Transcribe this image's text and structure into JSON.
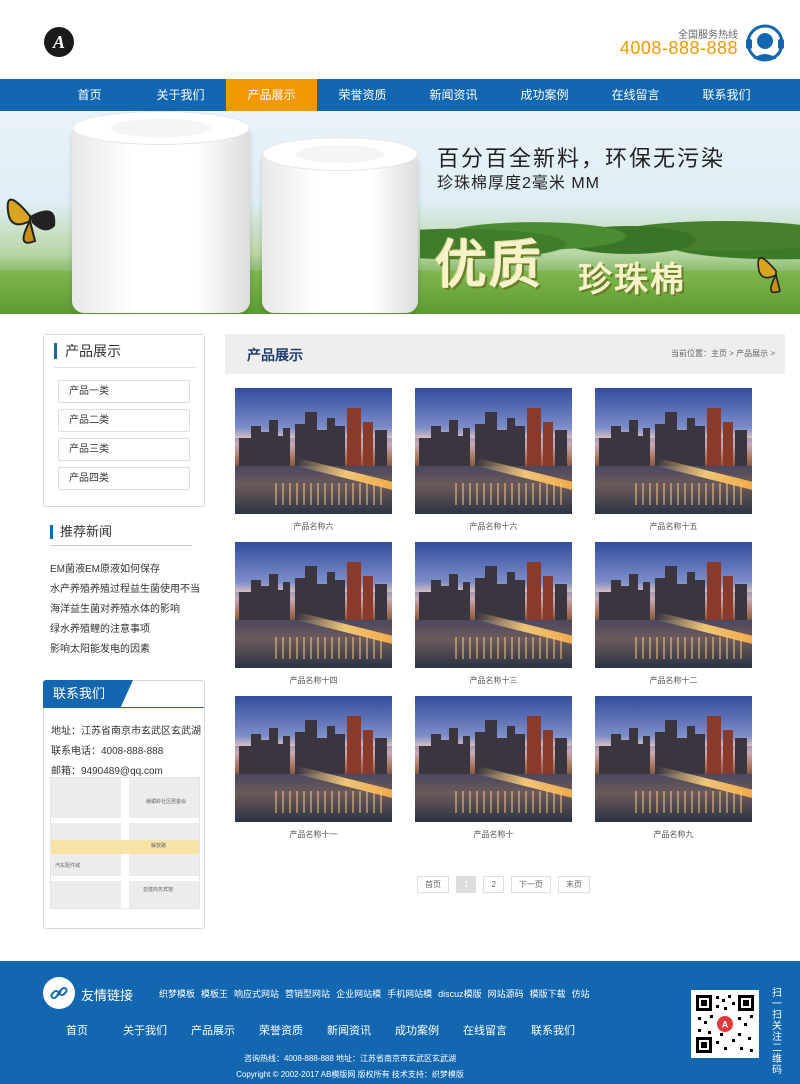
{
  "header": {
    "logo_letter": "A",
    "hotline_label": "全国服务热线",
    "hotline_number": "4008-888-888"
  },
  "nav": {
    "items": [
      "首页",
      "关于我们",
      "产品展示",
      "荣誉资质",
      "新闻资讯",
      "成功案例",
      "在线留言",
      "联系我们"
    ],
    "active": "产品展示"
  },
  "banner": {
    "line1": "百分百全新料，环保无污染",
    "line2": "珍珠棉厚度2毫米 MM",
    "big1": "优质",
    "big2": "珍珠棉"
  },
  "sidebar": {
    "category_title": "产品展示",
    "categories": [
      "产品一类",
      "产品二类",
      "产品三类",
      "产品四类"
    ],
    "news_title": "推荐新闻",
    "news": [
      "EM菌液EM原液如何保存",
      "水产养殖养殖过程益生菌使用不当",
      "海洋益生菌对养殖水体的影响",
      "绿水养殖鲤的注意事项",
      "影响太阳能发电的因素"
    ],
    "contact_title": "联系我们",
    "address": "地址：江苏省南京市玄武区玄武湖",
    "phone": "联系电话：4008-888-888",
    "email": "邮箱：9490489@qq.com",
    "map_labels": [
      "峨嵋岭社区居委会",
      "解放路",
      "汽车配件城",
      "亚建商务宾馆"
    ]
  },
  "main": {
    "section_title": "产品展示",
    "breadcrumb": "当前位置：主页 > 产品展示 >",
    "products": [
      "产品名称六",
      "产品名称十六",
      "产品名称十五",
      "产品名称十四",
      "产品名称十三",
      "产品名称十二",
      "产品名称十一",
      "产品名称十",
      "产品名称九"
    ],
    "pager": {
      "first": "首页",
      "pages": [
        "1",
        "2"
      ],
      "current": "1",
      "next": "下一页",
      "last": "末页"
    }
  },
  "footer": {
    "links_title": "友情链接",
    "links": [
      "织梦模板",
      "模板王",
      "响应式网站",
      "营销型网站",
      "企业网站模",
      "手机网站模",
      "discuz模版",
      "网站源码",
      "模版下载",
      "仿站"
    ],
    "nav": [
      "首页",
      "关于我们",
      "产品展示",
      "荣誉资质",
      "新闻资讯",
      "成功案例",
      "在线留言",
      "联系我们"
    ],
    "contact": "咨询热线：4008-888-888 地址：江苏省南京市玄武区玄武湖",
    "copyright": "Copyright © 2002-2017 AB模版网 版权所有 技术支持：织梦模版",
    "qr_text": "扫一扫关注二维码"
  },
  "colors": {
    "brand_blue": "#1367b0",
    "accent_orange": "#f39800"
  }
}
